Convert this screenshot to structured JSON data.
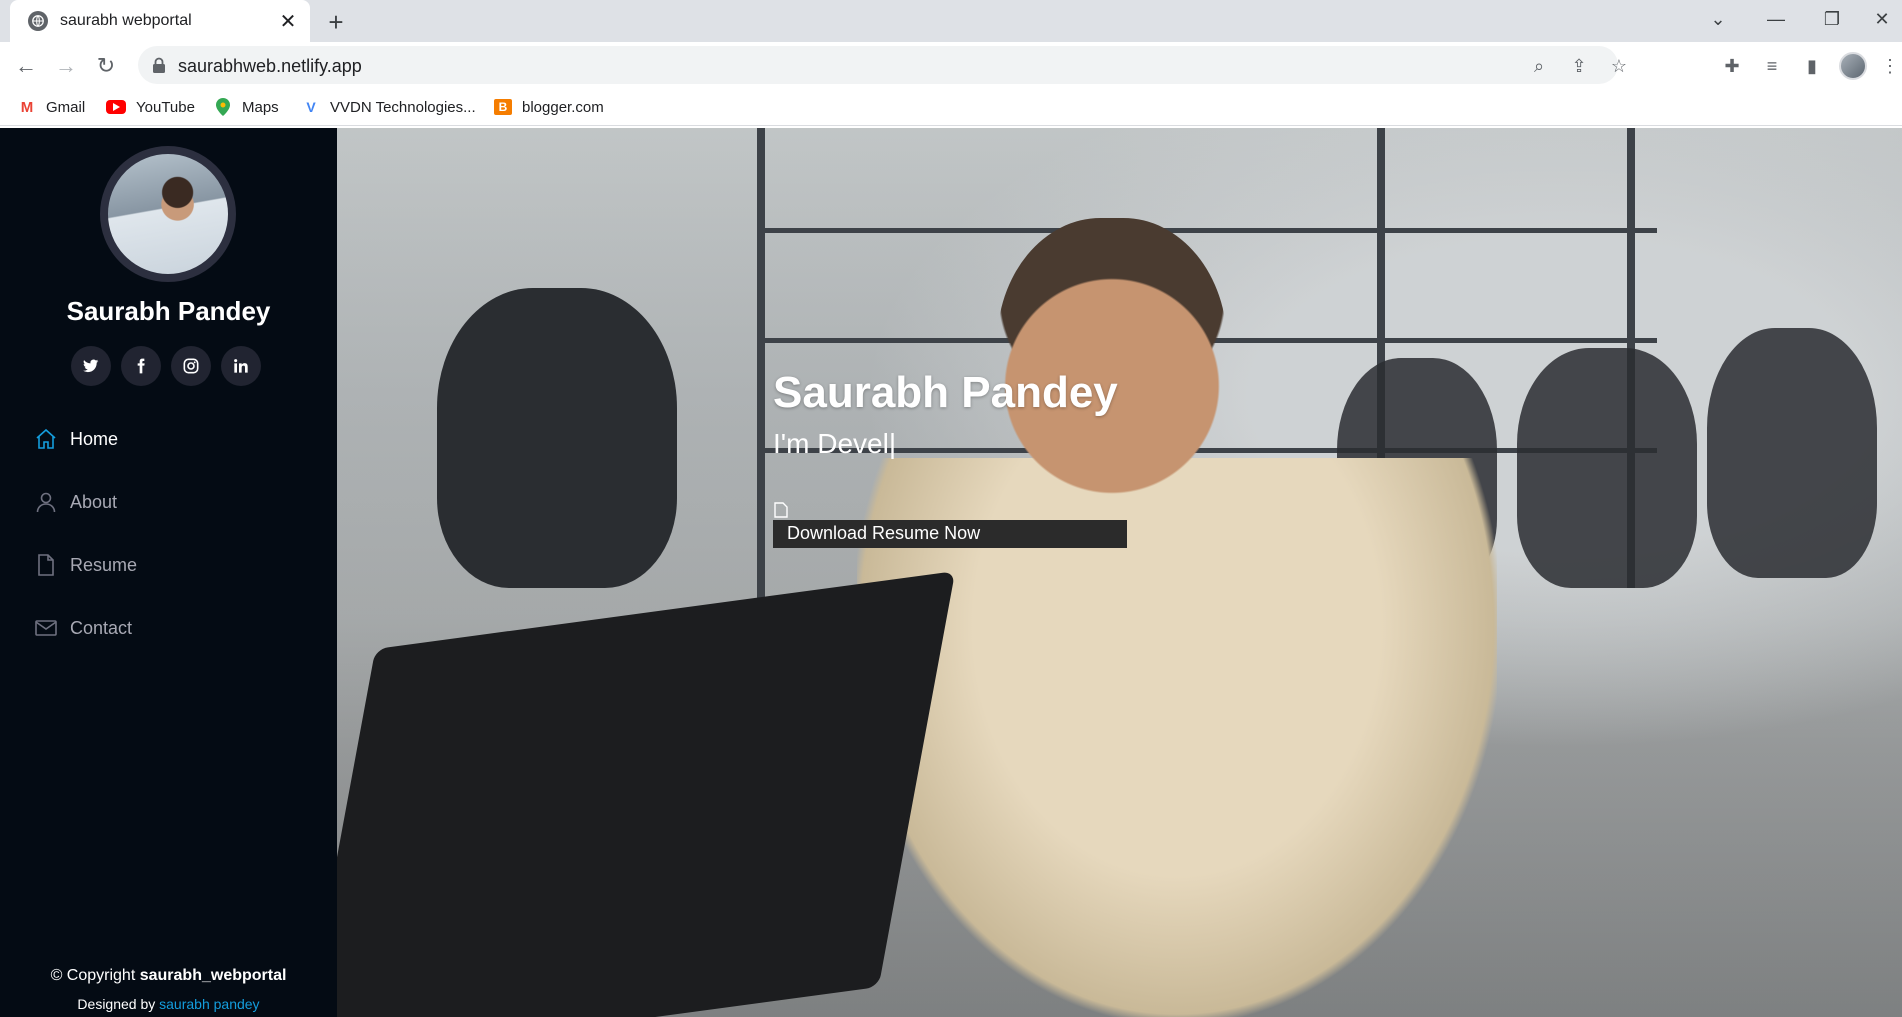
{
  "browser": {
    "tab_title": "saurabh webportal",
    "tab_close": "✕",
    "new_tab": "+",
    "url": "saurabhweb.netlify.app",
    "bookmarks": [
      {
        "label": "Gmail",
        "icon": "gmail-icon",
        "color": "#ea4335"
      },
      {
        "label": "YouTube",
        "icon": "youtube-icon",
        "color": "#ff0000"
      },
      {
        "label": "Maps",
        "icon": "maps-icon",
        "color": "#34a853"
      },
      {
        "label": "VVDN Technologies...",
        "icon": "vvdn-icon",
        "color": "#4285f4"
      },
      {
        "label": "blogger.com",
        "icon": "blogger-icon",
        "color": "#f57d00"
      }
    ]
  },
  "sidebar": {
    "name": "Saurabh Pandey",
    "socials": [
      "twitter-icon",
      "facebook-icon",
      "instagram-icon",
      "linkedin-icon"
    ],
    "nav": [
      {
        "label": "Home",
        "icon": "home-icon",
        "active": true
      },
      {
        "label": "About",
        "icon": "person-icon",
        "active": false
      },
      {
        "label": "Resume",
        "icon": "file-icon",
        "active": false
      },
      {
        "label": "Contact",
        "icon": "envelope-icon",
        "active": false
      }
    ],
    "footer": {
      "copyright_prefix": "© Copyright",
      "copyright_name": "saurabh_webportal",
      "designed_prefix": "Designed by",
      "designed_link": "saurabh pandey"
    }
  },
  "hero": {
    "title": "Saurabh Pandey",
    "subtitle": "I'm Devel|",
    "button": "Download Resume Now"
  },
  "colors": {
    "accent": "#149ddd",
    "sidebar_bg": "#040b14",
    "social_bg": "#212431"
  }
}
